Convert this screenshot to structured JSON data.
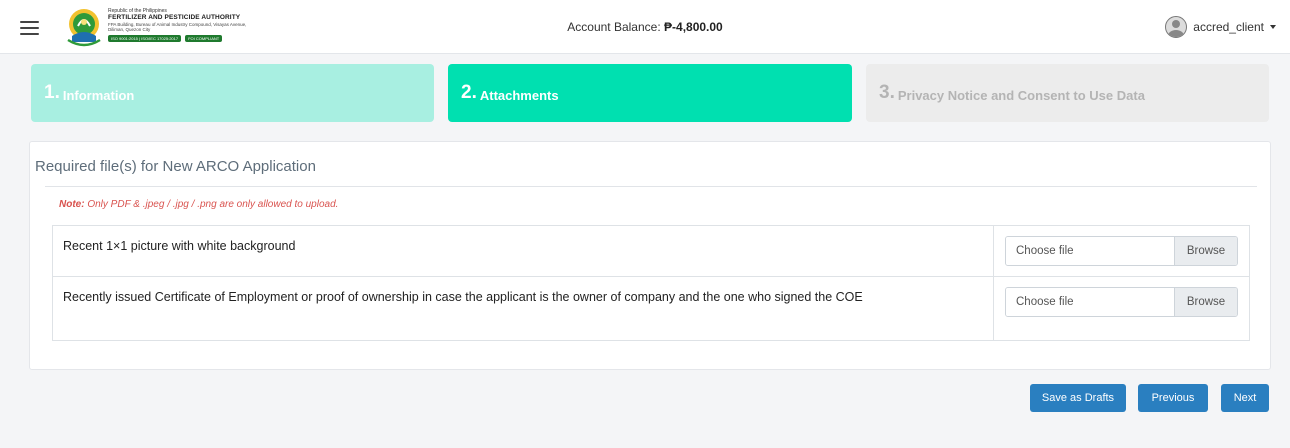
{
  "header": {
    "brand": {
      "line1": "Republic of the Philippines",
      "line2": "FERTILIZER AND PESTICIDE AUTHORITY",
      "line3": "FPA Building, Bureau of Animal Industry Compound, Visayas Avenue, Diliman, Quezon City",
      "pill1": "ISO 9001:2015 | ISO/IEC 17025:2017",
      "pill2": "FOI COMPLIANT"
    },
    "balance_label": "Account Balance:",
    "balance_value": "₱-4,800.00",
    "username": "accred_client"
  },
  "steps": [
    {
      "num": "1.",
      "label": "Information",
      "state": "completed"
    },
    {
      "num": "2.",
      "label": "Attachments",
      "state": "active"
    },
    {
      "num": "3.",
      "label": "Privacy Notice and Consent to Use Data",
      "state": "pending"
    }
  ],
  "card": {
    "title": "Required file(s) for New ARCO Application",
    "note_label": "Note:",
    "note_text": " Only PDF & .jpeg / .jpg / .png are only allowed to upload."
  },
  "files": [
    {
      "description": "Recent 1×1 picture with white background",
      "placeholder": "Choose file",
      "browse": "Browse"
    },
    {
      "description": "Recently issued Certificate of Employment or proof of ownership in case the applicant is the owner of company and the one who signed the COE",
      "placeholder": "Choose file",
      "browse": "Browse"
    }
  ],
  "buttons": {
    "save": "Save as Drafts",
    "previous": "Previous",
    "next": "Next"
  },
  "colors": {
    "step_completed": "#a8efe1",
    "step_active": "#00e0b0",
    "step_pending": "#ececec",
    "primary_button": "#2a7fc0",
    "note": "#d9534f"
  },
  "icons": [
    "hamburger-menu-icon",
    "fpa-logo",
    "user-avatar-icon",
    "caret-down-icon"
  ]
}
